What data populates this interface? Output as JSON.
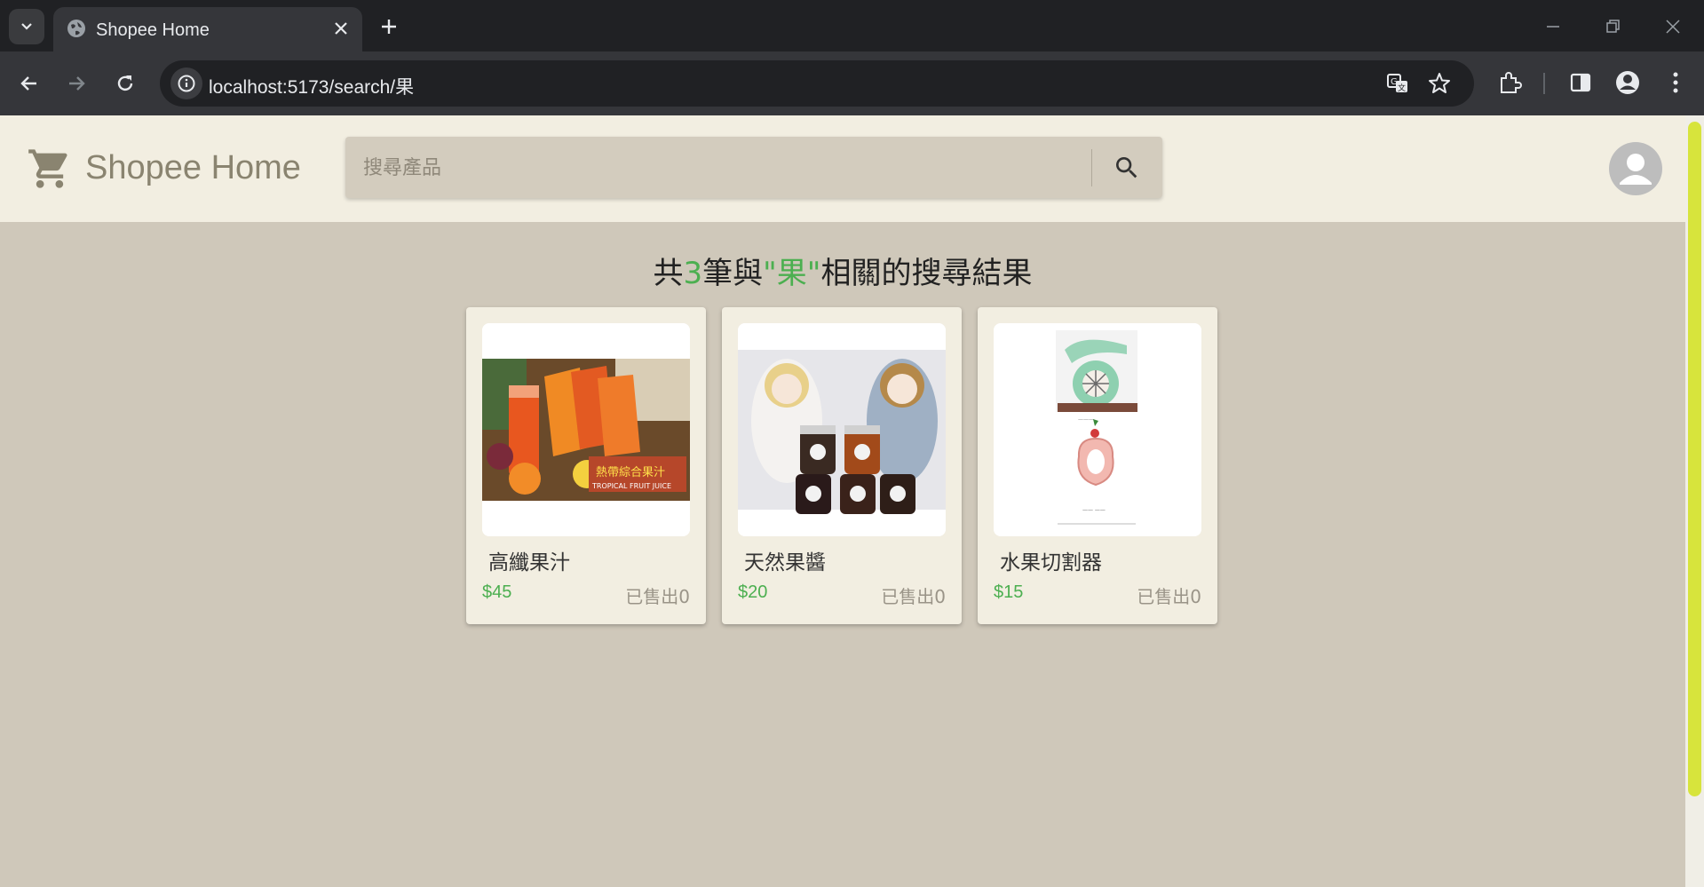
{
  "browser": {
    "tab_title": "Shopee Home",
    "url": "localhost:5173/search/果"
  },
  "app": {
    "brand": "Shopee Home",
    "search_placeholder": "搜尋產品"
  },
  "results": {
    "prefix": "共",
    "count": "3",
    "middle": "筆與",
    "query_quoted": "\"果\"",
    "suffix": "相關的搜尋結果"
  },
  "products": [
    {
      "name": "高纖果汁",
      "price": "$45",
      "sold": "已售出0",
      "image": "juice-photo"
    },
    {
      "name": "天然果醬",
      "price": "$20",
      "sold": "已售出0",
      "image": "jam-photo"
    },
    {
      "name": "水果切割器",
      "price": "$15",
      "sold": "已售出0",
      "image": "fruit-cutter-photo"
    }
  ],
  "colors": {
    "header_bg": "#f2eee1",
    "page_bg": "#cfc8ba",
    "accent_green": "#4caf50",
    "scroll_thumb": "#d7e43c"
  },
  "icons": [
    "cart-icon",
    "search-icon",
    "account-icon",
    "globe-icon",
    "close-icon",
    "plus-icon",
    "back-icon",
    "forward-icon",
    "reload-icon",
    "translate-icon",
    "star-icon",
    "extensions-icon",
    "side-panel-icon",
    "menu-icon"
  ]
}
